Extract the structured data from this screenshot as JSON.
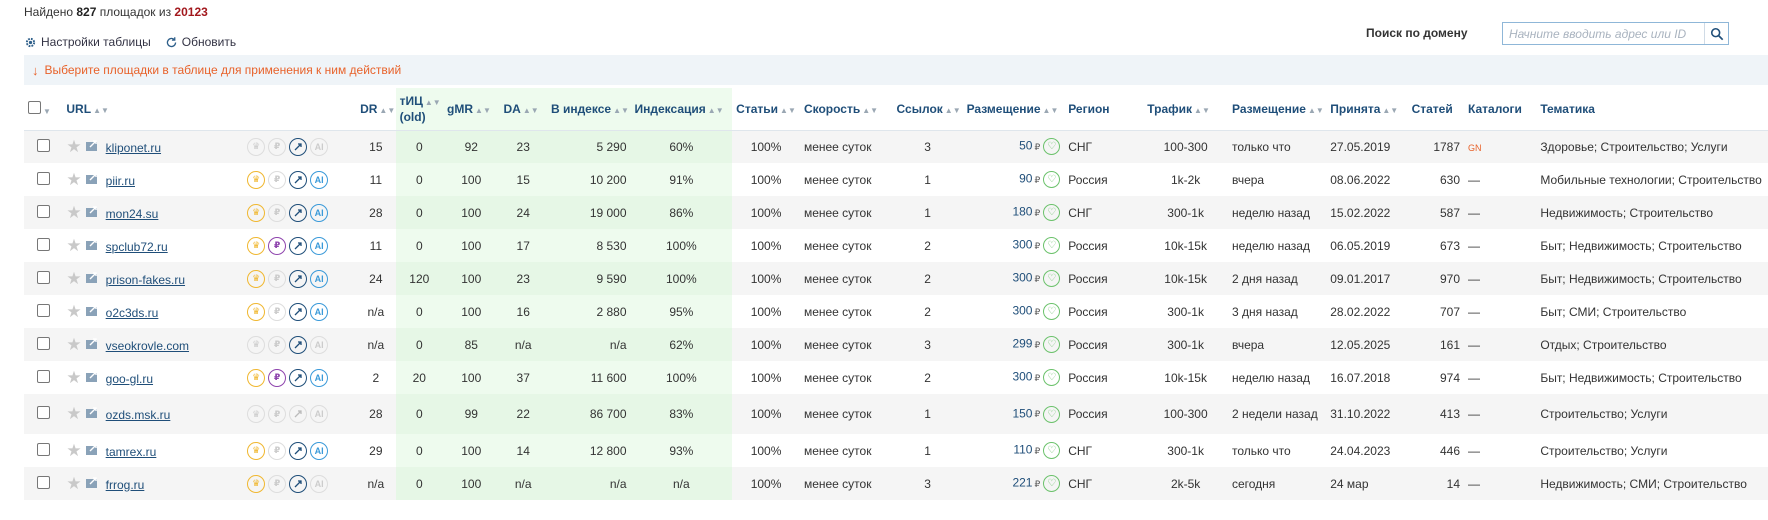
{
  "summary": {
    "prefix": "Найдено",
    "found": "827",
    "middle": "площадок из",
    "total": "20123"
  },
  "toolbar": {
    "settings_label": "Настройки таблицы",
    "refresh_label": "Обновить"
  },
  "search": {
    "label": "Поиск по домену",
    "placeholder": "Начните вводить адрес или ID"
  },
  "hint": {
    "text": "Выберите площадки в таблице для применения к ним действий"
  },
  "columns": {
    "url": "URL",
    "dr": "DR",
    "tic": "тИЦ",
    "tic_old": "(old)",
    "gmr": "gMR",
    "da": "DA",
    "index": "В индексе",
    "indexing": "Индексация",
    "articles": "Статьи",
    "speed": "Скорость",
    "links": "Ссылок",
    "placement": "Размещение",
    "region": "Регион",
    "traffic": "Трафик",
    "placement2": "Размещение",
    "accepted": "Принята",
    "count": "Статей",
    "catalogs": "Каталоги",
    "topics": "Тематика"
  },
  "currency": "₽",
  "rows": [
    {
      "url": "kliponet.ru",
      "badges": [
        "off",
        "off",
        "on",
        "off"
      ],
      "dr": "15",
      "tic": "0",
      "gmr": "92",
      "da": "23",
      "index": "5 290",
      "indexing": "60%",
      "articles": "100%",
      "speed": "менее суток",
      "links": "3",
      "price": "50",
      "region": "СНГ",
      "traffic": "100-300",
      "placement": "только что",
      "accepted": "27.05.2019",
      "count": "1787",
      "catalog": "GN",
      "topics": "Здоровье; Строительство; Услуги"
    },
    {
      "url": "piir.ru",
      "badges": [
        "on",
        "off",
        "on",
        "on"
      ],
      "dr": "11",
      "tic": "0",
      "gmr": "100",
      "da": "15",
      "index": "10 200",
      "indexing": "91%",
      "articles": "100%",
      "speed": "менее суток",
      "links": "1",
      "price": "90",
      "region": "Россия",
      "traffic": "1k-2k",
      "placement": "вчера",
      "accepted": "08.06.2022",
      "count": "630",
      "catalog": "—",
      "topics": "Мобильные технологии; Строительство"
    },
    {
      "url": "mon24.su",
      "badges": [
        "on",
        "off",
        "on",
        "on"
      ],
      "dr": "28",
      "tic": "0",
      "gmr": "100",
      "da": "24",
      "index": "19 000",
      "indexing": "86%",
      "articles": "100%",
      "speed": "менее суток",
      "links": "1",
      "price": "180",
      "region": "СНГ",
      "traffic": "300-1k",
      "placement": "неделю назад",
      "accepted": "15.02.2022",
      "count": "587",
      "catalog": "—",
      "topics": "Недвижимость; Строительство"
    },
    {
      "url": "spclub72.ru",
      "badges": [
        "on",
        "on",
        "on",
        "on"
      ],
      "dr": "11",
      "tic": "0",
      "gmr": "100",
      "da": "17",
      "index": "8 530",
      "indexing": "100%",
      "articles": "100%",
      "speed": "менее суток",
      "links": "2",
      "price": "300",
      "region": "Россия",
      "traffic": "10k-15k",
      "placement": "неделю назад",
      "accepted": "06.05.2019",
      "count": "673",
      "catalog": "—",
      "topics": "Быт; Недвижимость; Строительство"
    },
    {
      "url": "prison-fakes.ru",
      "badges": [
        "on",
        "off",
        "on",
        "on"
      ],
      "dr": "24",
      "tic": "120",
      "gmr": "100",
      "da": "23",
      "index": "9 590",
      "indexing": "100%",
      "articles": "100%",
      "speed": "менее суток",
      "links": "2",
      "price": "300",
      "region": "Россия",
      "traffic": "10k-15k",
      "placement": "2 дня назад",
      "accepted": "09.01.2017",
      "count": "970",
      "catalog": "—",
      "topics": "Быт; Недвижимость; Строительство"
    },
    {
      "url": "o2c3ds.ru",
      "badges": [
        "on",
        "off",
        "on",
        "on"
      ],
      "dr": "n/a",
      "tic": "0",
      "gmr": "100",
      "da": "16",
      "index": "2 880",
      "indexing": "95%",
      "articles": "100%",
      "speed": "менее суток",
      "links": "2",
      "price": "300",
      "region": "Россия",
      "traffic": "300-1k",
      "placement": "3 дня назад",
      "accepted": "28.02.2022",
      "count": "707",
      "catalog": "—",
      "topics": "Быт; СМИ; Строительство"
    },
    {
      "url": "vseokrovle.com",
      "badges": [
        "off",
        "off",
        "on",
        "off"
      ],
      "dr": "n/a",
      "tic": "0",
      "gmr": "85",
      "da": "n/a",
      "index": "n/a",
      "indexing": "62%",
      "articles": "100%",
      "speed": "менее суток",
      "links": "3",
      "price": "299",
      "region": "Россия",
      "traffic": "300-1k",
      "placement": "вчера",
      "accepted": "12.05.2025",
      "count": "161",
      "catalog": "—",
      "topics": "Отдых; Строительство"
    },
    {
      "url": "goo-gl.ru",
      "badges": [
        "on",
        "on",
        "on",
        "on"
      ],
      "dr": "2",
      "tic": "20",
      "gmr": "100",
      "da": "37",
      "index": "11 600",
      "indexing": "100%",
      "articles": "100%",
      "speed": "менее суток",
      "links": "2",
      "price": "300",
      "region": "Россия",
      "traffic": "10k-15k",
      "placement": "неделю назад",
      "accepted": "16.07.2018",
      "count": "974",
      "catalog": "—",
      "topics": "Быт; Недвижимость; Строительство"
    },
    {
      "url": "ozds.msk.ru",
      "badges": [
        "off",
        "off",
        "off",
        "off"
      ],
      "dr": "28",
      "tic": "0",
      "gmr": "99",
      "da": "22",
      "index": "86 700",
      "indexing": "83%",
      "articles": "100%",
      "speed": "менее суток",
      "links": "1",
      "price": "150",
      "region": "Россия",
      "traffic": "100-300",
      "placement": "2 недели назад",
      "accepted": "31.10.2022",
      "count": "413",
      "catalog": "—",
      "topics": "Строительство; Услуги"
    },
    {
      "url": "tamrex.ru",
      "badges": [
        "on",
        "off",
        "on",
        "on"
      ],
      "dr": "29",
      "tic": "0",
      "gmr": "100",
      "da": "14",
      "index": "12 800",
      "indexing": "93%",
      "articles": "100%",
      "speed": "менее суток",
      "links": "1",
      "price": "110",
      "region": "СНГ",
      "traffic": "300-1k",
      "placement": "только что",
      "accepted": "24.04.2023",
      "count": "446",
      "catalog": "—",
      "topics": "Строительство; Услуги"
    },
    {
      "url": "frrog.ru",
      "badges": [
        "on",
        "off",
        "on",
        "off"
      ],
      "dr": "n/a",
      "tic": "0",
      "gmr": "100",
      "da": "n/a",
      "index": "n/a",
      "indexing": "n/a",
      "articles": "100%",
      "speed": "менее суток",
      "links": "3",
      "price": "221",
      "region": "СНГ",
      "traffic": "2k-5k",
      "placement": "сегодня",
      "accepted": "24 мар",
      "count": "14",
      "catalog": "—",
      "topics": "Недвижимость; СМИ; Строительство"
    }
  ]
}
